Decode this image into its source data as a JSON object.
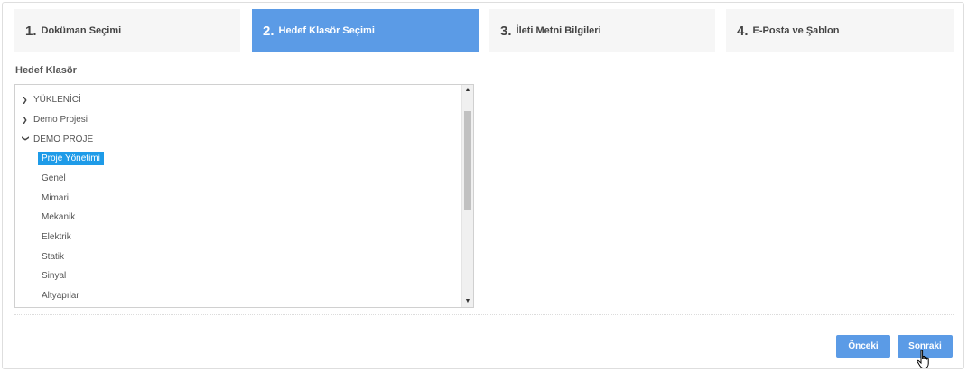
{
  "steps": [
    {
      "num": "1.",
      "label": "Doküman Seçimi"
    },
    {
      "num": "2.",
      "label": "Hedef Klasör Seçimi"
    },
    {
      "num": "3.",
      "label": "İleti Metni Bilgileri"
    },
    {
      "num": "4.",
      "label": "E-Posta ve Şablon"
    }
  ],
  "active_step": 2,
  "colors": {
    "accent": "#5b9be6",
    "selection": "#1e9be8"
  },
  "folder_section": {
    "label": "Hedef Klasör"
  },
  "tree": {
    "roots": [
      {
        "label": "YÜKLENİCİ",
        "icon": "chevron-right-icon"
      },
      {
        "label": "Demo Projesi",
        "icon": "chevron-right-icon"
      },
      {
        "label": "DEMO PROJE",
        "icon": "chevron-down-icon"
      }
    ],
    "children": [
      "Proje Yönetimi",
      "Genel",
      "Mimari",
      "Mekanik",
      "Elektrik",
      "Statik",
      "Sinyal",
      "Altyapılar"
    ],
    "selected": "Proje Yönetimi"
  },
  "buttons": {
    "prev": "Önceki",
    "next": "Sonraki"
  }
}
